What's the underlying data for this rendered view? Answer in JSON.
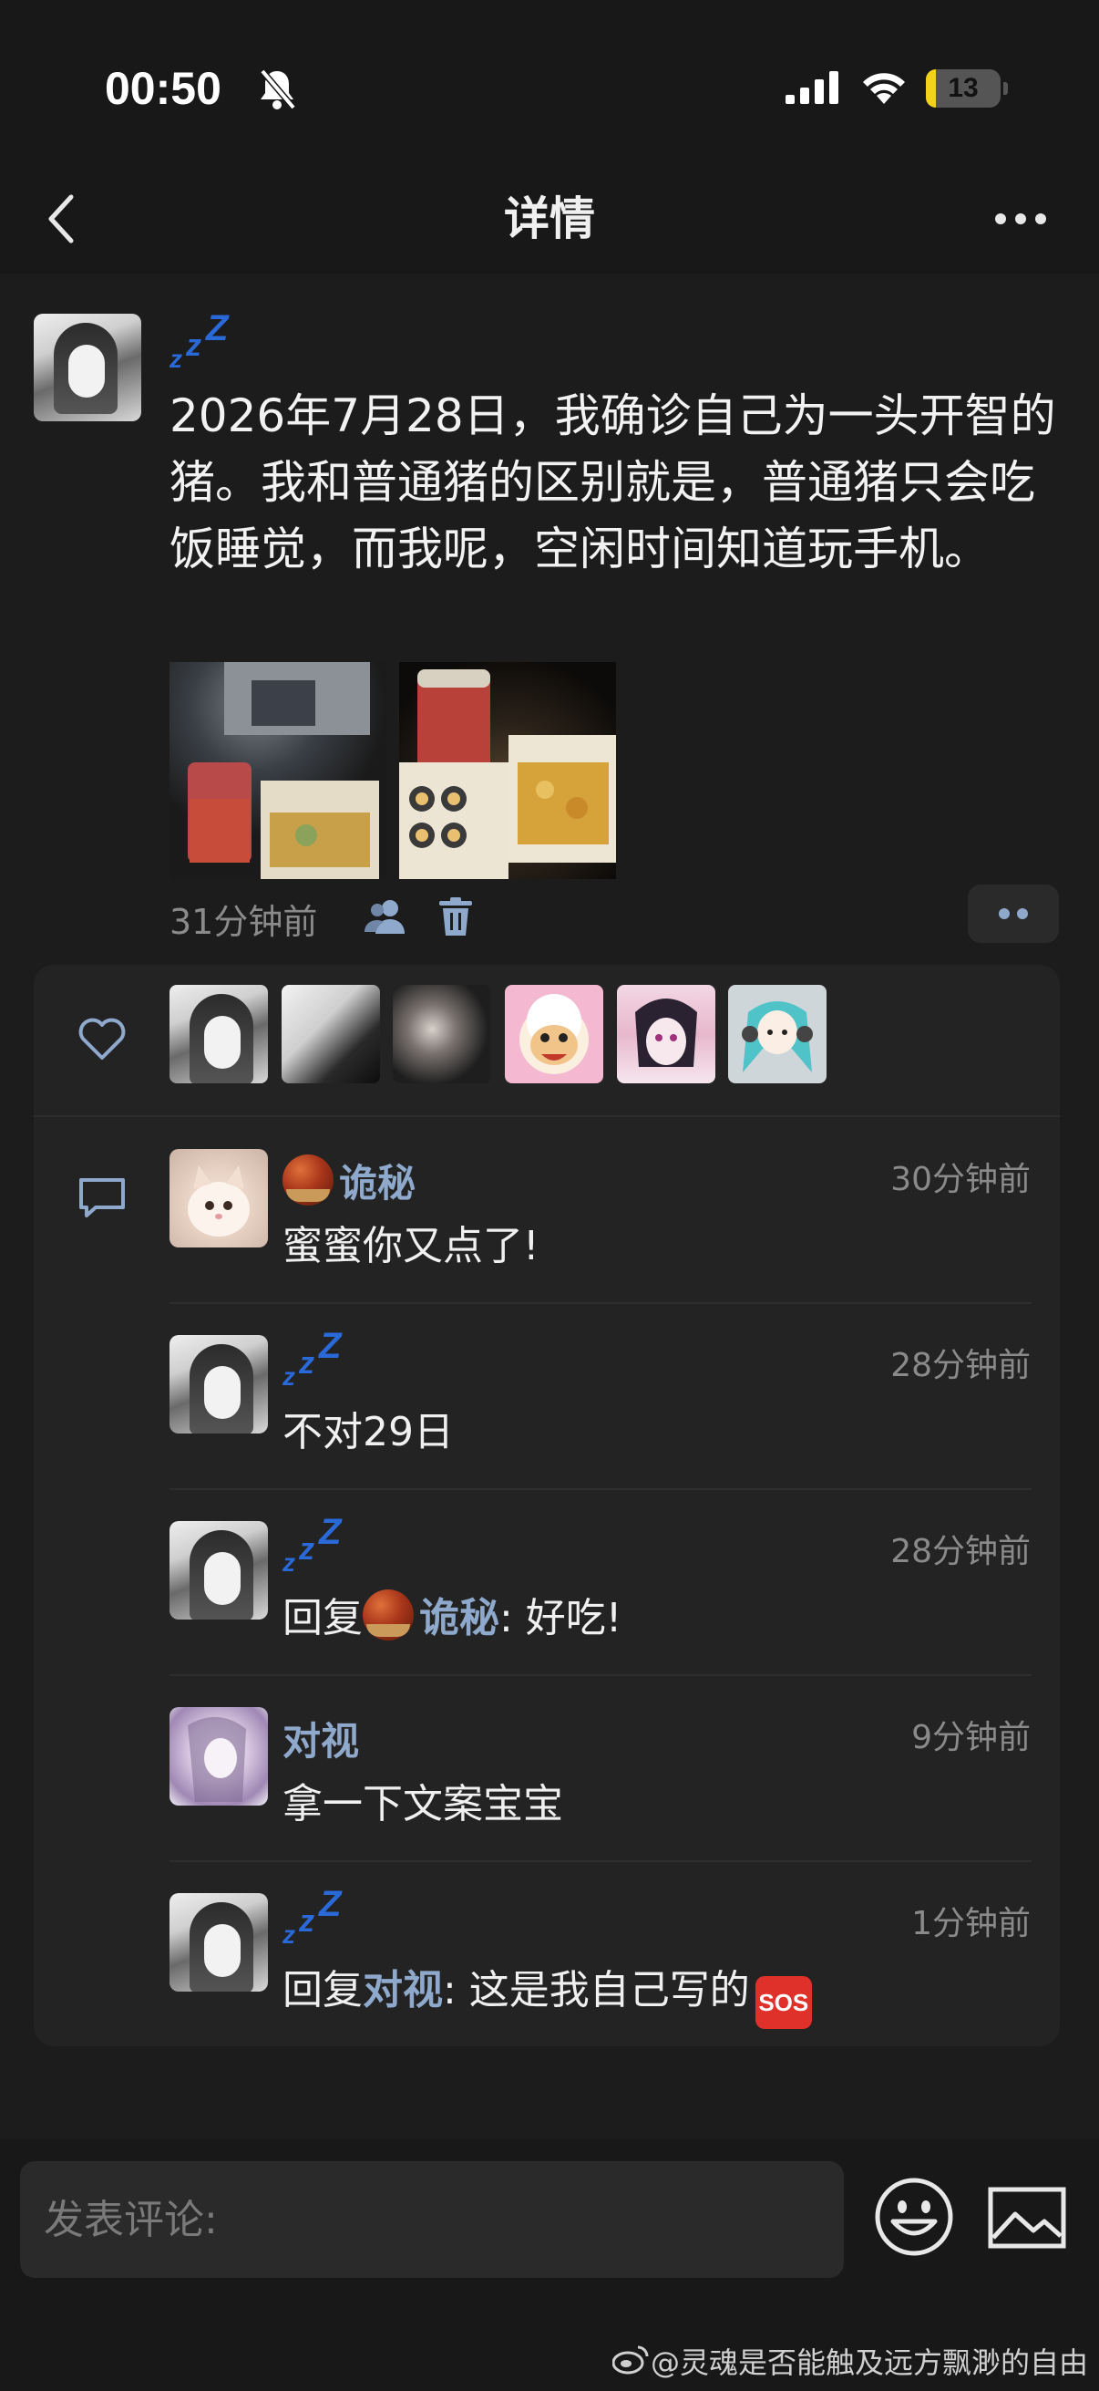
{
  "status_bar": {
    "time": "00:50",
    "battery": "13",
    "battery_fraction": 0.13,
    "icons": [
      "bell-slash-icon",
      "cellular-signal-icon",
      "wifi-icon",
      "battery-icon"
    ]
  },
  "nav": {
    "title": "详情",
    "back_icon": "chevron-left-icon",
    "more_icon": "ellipsis-icon"
  },
  "post": {
    "author_name": "zzz",
    "text": "2026年7月28日，我确诊自己为一头开智的猪。我和普通猪的区别就是，普通猪只会吃饭睡觉，而我呢，空闲时间知道玩手机。",
    "image_count": 2,
    "time": "31分钟前",
    "icons": [
      "people-icon",
      "trash-icon",
      "more-dots-icon"
    ]
  },
  "likes": {
    "icon": "heart-outline-icon",
    "liker_count": 6
  },
  "comments": [
    {
      "name": "诡秘",
      "has_chestnut": true,
      "time": "30分钟前",
      "text": "蜜蜜你又点了!"
    },
    {
      "name": "zzz",
      "time": "28分钟前",
      "text": "不对29日"
    },
    {
      "name": "zzz",
      "time": "28分钟前",
      "reply_prefix": "回复",
      "reply_to": "诡秘",
      "reply_text": ": 好吃!"
    },
    {
      "name": "对视",
      "time": "9分钟前",
      "text": "拿一下文案宝宝"
    },
    {
      "name": "zzz",
      "time": "1分钟前",
      "reply_prefix": "回复",
      "reply_to": "对视",
      "reply_text": ": 这是我自己写的",
      "sos": "SOS"
    }
  ],
  "input": {
    "placeholder": "发表评论:",
    "emoji_icon": "emoji-icon",
    "image_icon": "image-icon"
  },
  "watermark": "@灵魂是否能触及远方飘渺的自由"
}
